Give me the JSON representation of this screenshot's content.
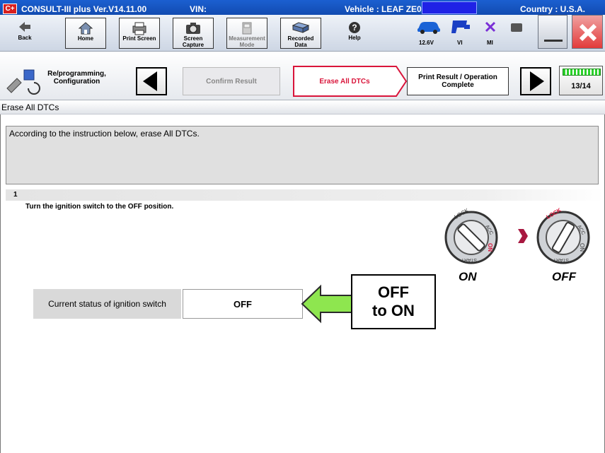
{
  "titlebar": {
    "logo": "C+",
    "app": "CONSULT-III plus  Ver.V14.11.00",
    "vin_label": "VIN:",
    "vehicle": "Vehicle : LEAF ZE0",
    "country": "Country : U.S.A."
  },
  "toolbar": {
    "buttons": [
      {
        "label": "Back",
        "icon": "back-arrow-icon"
      },
      {
        "label": "Home",
        "icon": "home-icon"
      },
      {
        "label": "Print Screen",
        "icon": "printer-icon"
      },
      {
        "label": "Screen Capture",
        "icon": "camera-icon"
      },
      {
        "label": "Measurement Mode",
        "icon": "measurement-icon"
      },
      {
        "label": "Recorded Data",
        "icon": "recorded-data-icon"
      },
      {
        "label": "Help",
        "icon": "help-icon"
      }
    ],
    "status": {
      "voltage": "12.6V",
      "vi": "VI",
      "mi": "MI"
    }
  },
  "stepbar": {
    "reprog_label": "Re/programming, Configuration",
    "steps": [
      {
        "label": "Confirm Result",
        "state": "done"
      },
      {
        "label": "Erase All DTCs",
        "state": "active"
      },
      {
        "label": "Print Result / Operation Complete",
        "state": "next"
      }
    ],
    "progress": "13/14"
  },
  "page_title": "Erase All DTCs",
  "instruction": "According to the instruction below, erase All DTCs.",
  "step": {
    "number": "1",
    "text": "Turn the ignition switch to the OFF position."
  },
  "ignition": {
    "status_label": "Current status of ignition switch",
    "status_value": "OFF",
    "from_caption": "ON",
    "to_caption": "OFF",
    "key_labels": [
      "LOCK",
      "ACC",
      "ON",
      "START"
    ]
  },
  "callout": {
    "line1": "OFF",
    "line2": "to ON"
  },
  "colors": {
    "titlebar": "#0c3f9e",
    "active_step": "#d9143a",
    "arrow_fill": "#8ee64f",
    "battery_green": "#2bd12b"
  }
}
